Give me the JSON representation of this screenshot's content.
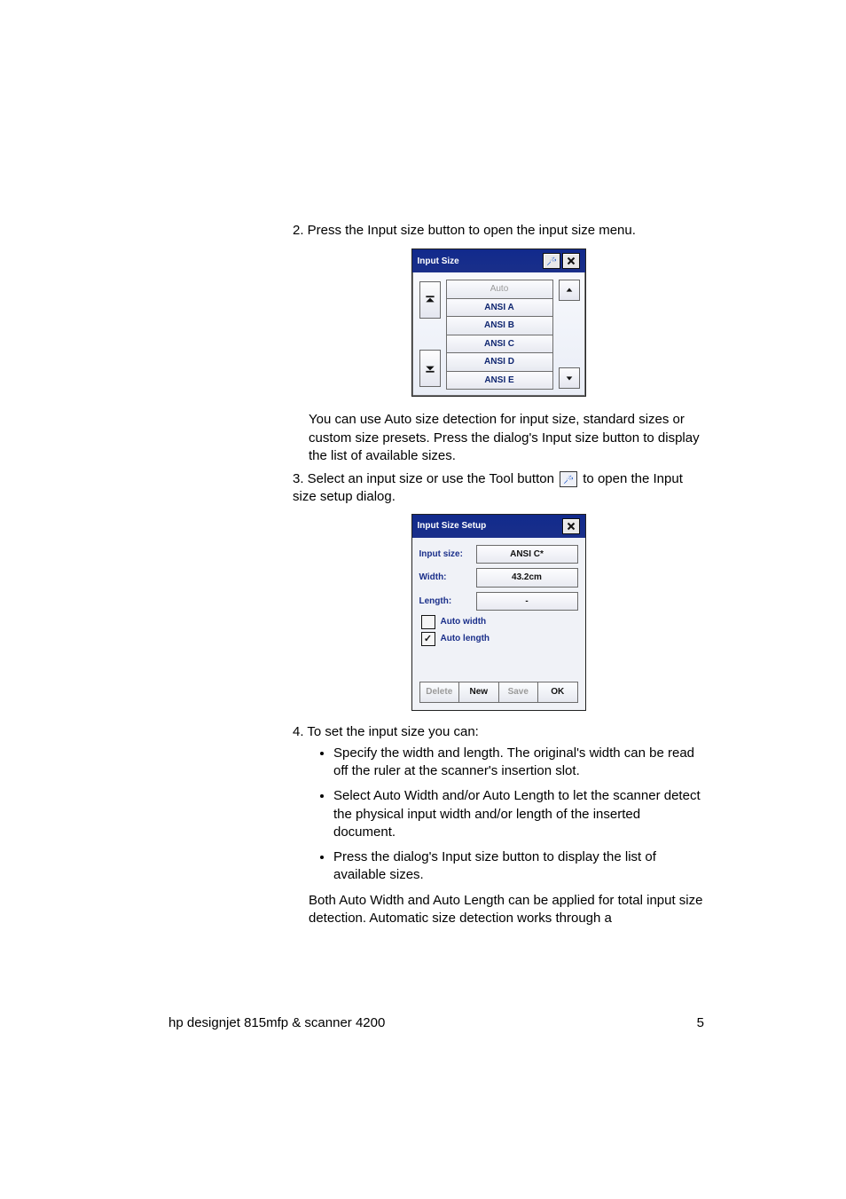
{
  "step2": "2. Press the Input size button to open the input size menu.",
  "menu": {
    "title": "Input Size",
    "items": [
      "Auto",
      "ANSI A",
      "ANSI B",
      "ANSI C",
      "ANSI D",
      "ANSI E"
    ]
  },
  "para1": "You can use Auto size detection for input size, standard sizes or custom size presets. Press the dialog's Input size button to display the list of available sizes.",
  "step3a": "3. Select an input size or use the Tool button ",
  "step3b": " to open the Input size setup dialog.",
  "setup": {
    "title": "Input Size Setup",
    "labels": {
      "inputsize": "Input size:",
      "width": "Width:",
      "length": "Length:"
    },
    "values": {
      "inputsize": "ANSI C*",
      "width": "43.2cm",
      "length": "-"
    },
    "cb": {
      "autowidth": "Auto width",
      "autolength": "Auto length"
    },
    "buttons": {
      "delete": "Delete",
      "new": "New",
      "save": "Save",
      "ok": "OK"
    }
  },
  "step4": "4. To set the input size you can:",
  "bullets": [
    "Specify the width and length. The original's width can be read off the ruler at the scanner's insertion slot.",
    "Select Auto Width and/or Auto Length to let the scanner detect the physical input width and/or length of the inserted document.",
    "Press the dialog's Input size button to display the list of available sizes."
  ],
  "para2": "Both Auto Width and Auto Length can be applied for total input size detection. Automatic size detection works through a",
  "footer": {
    "left": "hp designjet 815mfp & scanner 4200",
    "right": "5"
  }
}
